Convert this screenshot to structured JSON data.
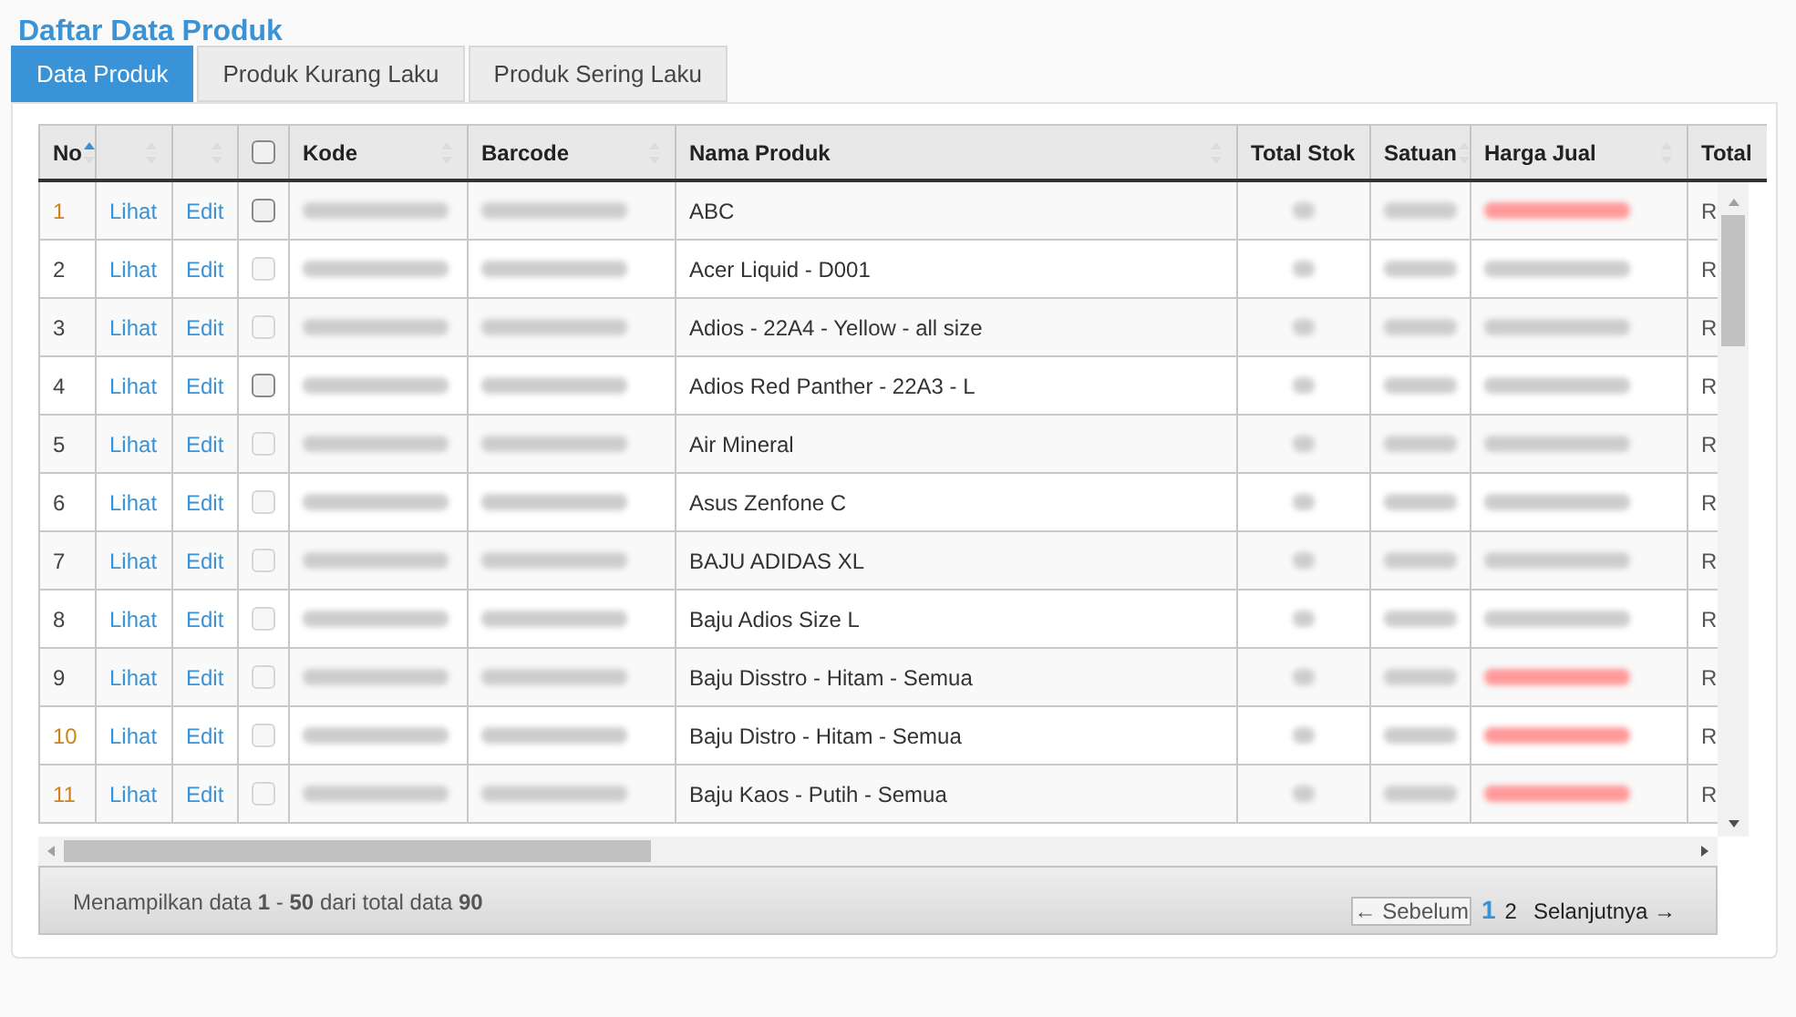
{
  "title": "Daftar Data Produk",
  "tabs": [
    {
      "label": "Data Produk",
      "selected": true
    },
    {
      "label": "Produk Kurang Laku",
      "selected": false
    },
    {
      "label": "Produk Sering Laku",
      "selected": false
    }
  ],
  "table": {
    "columns": [
      {
        "label": "No",
        "kind": "text",
        "sortable": true,
        "sorted": true
      },
      {
        "kind": "blank",
        "sortable": true,
        "sorted": false
      },
      {
        "kind": "blank",
        "sortable": true,
        "sorted": false
      },
      {
        "kind": "checkbox",
        "checked": false
      },
      {
        "label": "Kode",
        "kind": "text",
        "sortable": true,
        "sorted": false
      },
      {
        "label": "Barcode",
        "kind": "text",
        "sortable": true,
        "sorted": false
      },
      {
        "label": "Nama Produk",
        "kind": "text",
        "sortable": true,
        "sorted": false
      },
      {
        "label": "Total Stok",
        "kind": "text"
      },
      {
        "label": "Satuan",
        "kind": "text",
        "sortable": true,
        "sorted": false
      },
      {
        "label": "Harga Jual",
        "kind": "text",
        "sortable": true,
        "sorted": false
      },
      {
        "label": "Total",
        "kind": "text"
      }
    ],
    "rows": [
      {
        "no": "1",
        "highlight": true,
        "view": "Lihat",
        "edit": "Edit",
        "checked": false,
        "disabled": false,
        "name": "ABC",
        "price_alert": true,
        "total": "R"
      },
      {
        "no": "2",
        "highlight": false,
        "view": "Lihat",
        "edit": "Edit",
        "checked": false,
        "disabled": true,
        "name": "Acer Liquid - D001",
        "price_alert": false,
        "total": "R"
      },
      {
        "no": "3",
        "highlight": false,
        "view": "Lihat",
        "edit": "Edit",
        "checked": false,
        "disabled": true,
        "name": "Adios - 22A4 - Yellow - all size",
        "price_alert": false,
        "total": "R"
      },
      {
        "no": "4",
        "highlight": false,
        "view": "Lihat",
        "edit": "Edit",
        "checked": false,
        "disabled": false,
        "name": "Adios Red Panther - 22A3 - L",
        "price_alert": false,
        "total": "R"
      },
      {
        "no": "5",
        "highlight": false,
        "view": "Lihat",
        "edit": "Edit",
        "checked": false,
        "disabled": true,
        "name": "Air Mineral",
        "price_alert": false,
        "total": "R"
      },
      {
        "no": "6",
        "highlight": false,
        "view": "Lihat",
        "edit": "Edit",
        "checked": false,
        "disabled": true,
        "name": "Asus Zenfone C",
        "price_alert": false,
        "total": "R"
      },
      {
        "no": "7",
        "highlight": false,
        "view": "Lihat",
        "edit": "Edit",
        "checked": false,
        "disabled": true,
        "name": "BAJU ADIDAS XL",
        "price_alert": false,
        "total": "R"
      },
      {
        "no": "8",
        "highlight": false,
        "view": "Lihat",
        "edit": "Edit",
        "checked": false,
        "disabled": true,
        "name": "Baju Adios Size L",
        "price_alert": false,
        "total": "R"
      },
      {
        "no": "9",
        "highlight": false,
        "view": "Lihat",
        "edit": "Edit",
        "checked": false,
        "disabled": true,
        "name": "Baju Disstro - Hitam - Semua",
        "price_alert": true,
        "total": "R"
      },
      {
        "no": "10",
        "highlight": true,
        "view": "Lihat",
        "edit": "Edit",
        "checked": false,
        "disabled": true,
        "name": "Baju Distro - Hitam - Semua",
        "price_alert": true,
        "total": "R"
      },
      {
        "no": "11",
        "highlight": true,
        "view": "Lihat",
        "edit": "Edit",
        "checked": false,
        "disabled": true,
        "name": "Baju Kaos - Putih - Semua",
        "price_alert": true,
        "total": "R"
      }
    ]
  },
  "footer": {
    "summary": "Menampilkan data **1** - **50** dari total data **90**"
  },
  "pagination": {
    "prev": "← Sebelum",
    "pages": [
      {
        "label": "1",
        "selected": true
      },
      {
        "label": "2",
        "selected": false
      }
    ],
    "next": "Selanjutnya →"
  }
}
